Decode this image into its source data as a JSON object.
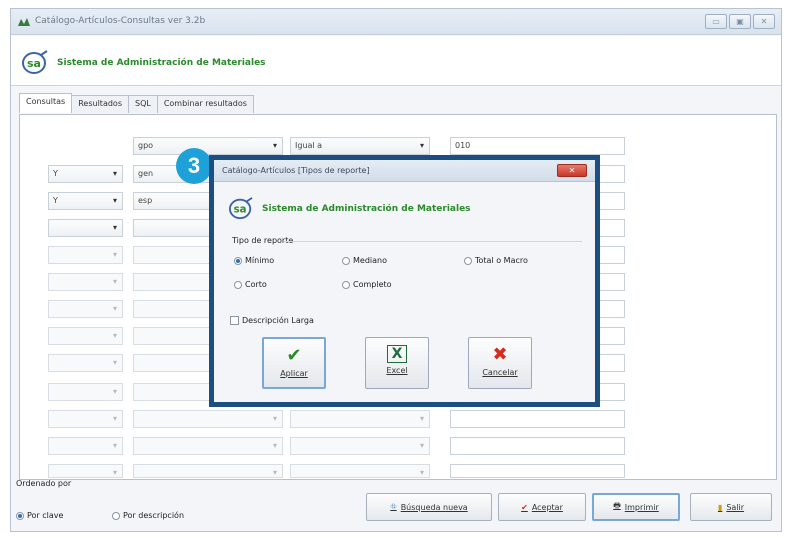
{
  "window": {
    "title": "Catálogo-Artículos-Consultas ver 3.2b",
    "buttons": [
      "minimize",
      "maximize",
      "close"
    ]
  },
  "header": {
    "title": "Sistema de Administración de Materiales"
  },
  "tabs": [
    {
      "label": "Consultas",
      "active": true
    },
    {
      "label": "Resultados",
      "active": false
    },
    {
      "label": "SQL",
      "active": false
    },
    {
      "label": "Combinar resultados",
      "active": false
    }
  ],
  "criteria": {
    "rows": [
      {
        "connector": "",
        "field": "gpo",
        "operator": "Igual a",
        "value": "010"
      },
      {
        "connector": "Y",
        "field": "gen",
        "operator": "",
        "value": ""
      },
      {
        "connector": "Y",
        "field": "esp",
        "operator": "",
        "value": ""
      },
      {
        "connector": "",
        "field": "",
        "operator": "",
        "value": ""
      }
    ]
  },
  "footer": {
    "order_label": "Ordenado por",
    "order_options": [
      {
        "label": "Por clave",
        "selected": true
      },
      {
        "label": "Por descripción",
        "selected": false
      }
    ],
    "buttons": {
      "new_search": "Búsqueda nueva",
      "accept": "Aceptar",
      "print": "Imprimir",
      "exit": "Salir"
    }
  },
  "step_badge": "3",
  "dialog": {
    "title": "Catálogo-Artículos [Tipos de reporte]",
    "heading": "Sistema de Administración de Materiales",
    "group_label": "Tipo de reporte",
    "options": [
      {
        "label": "Mínimo",
        "selected": true
      },
      {
        "label": "Mediano",
        "selected": false
      },
      {
        "label": "Total o Macro",
        "selected": false
      },
      {
        "label": "Corto",
        "selected": false
      },
      {
        "label": "Completo",
        "selected": false
      }
    ],
    "long_desc_label": "Descripción Larga",
    "long_desc_checked": false,
    "buttons": {
      "apply": "Aplicar",
      "excel": "Excel",
      "cancel": "Cancelar"
    }
  },
  "colors": {
    "accent_green": "#2b8a2b",
    "dialog_border": "#1c4e80",
    "badge": "#1ea1d8",
    "close_red": "#c9382a"
  }
}
